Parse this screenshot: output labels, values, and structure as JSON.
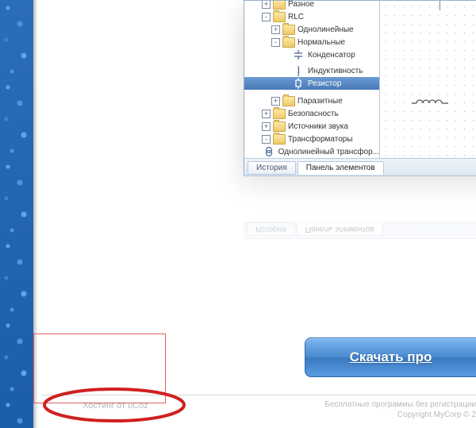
{
  "tree": {
    "items": [
      {
        "indent": 22,
        "toggle": "+",
        "type": "folder",
        "label": "Разное"
      },
      {
        "indent": 22,
        "toggle": "-",
        "type": "folder",
        "label": "RLC"
      },
      {
        "indent": 34,
        "toggle": "+",
        "type": "folder",
        "label": "Однолинейные"
      },
      {
        "indent": 34,
        "toggle": "-",
        "type": "folder",
        "label": "Нормальные"
      },
      {
        "indent": 46,
        "toggle": "",
        "type": "cap",
        "label": "Конденсатор"
      },
      {
        "indent": 46,
        "toggle": "",
        "type": "ind",
        "label": "Индуктивность"
      },
      {
        "indent": 46,
        "toggle": "",
        "type": "res",
        "label": "Резистор",
        "selected": true
      },
      {
        "indent": 34,
        "toggle": "+",
        "type": "folder",
        "label": "Паразитные"
      },
      {
        "indent": 22,
        "toggle": "+",
        "type": "folder",
        "label": "Безопасность"
      },
      {
        "indent": 22,
        "toggle": "+",
        "type": "folder",
        "label": "Источники звука"
      },
      {
        "indent": 22,
        "toggle": "-",
        "type": "folder",
        "label": "Трансформаторы"
      },
      {
        "indent": 34,
        "toggle": "",
        "type": "trans",
        "label": "Однолинейный трансфор..."
      }
    ]
  },
  "tabs": {
    "history": "История",
    "panel": "Панель элементов"
  },
  "download": "Скачать   про",
  "footer": {
    "hosting": "Хостинг от uCoz",
    "line1": "Бесплатные программы без регистрации",
    "line2": "Copyright MyCorp © 2"
  }
}
